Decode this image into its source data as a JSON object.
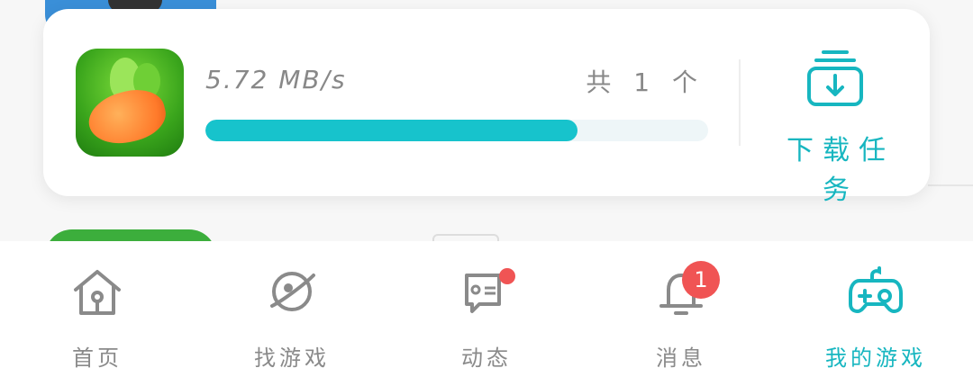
{
  "download_card": {
    "speed": "5.72 MB/s",
    "count": "共 1 个",
    "progress_percent": 74,
    "task_label": "下载任务"
  },
  "tabs": [
    {
      "label": "首页",
      "icon": "home-icon",
      "active": false
    },
    {
      "label": "找游戏",
      "icon": "planet-icon",
      "active": false
    },
    {
      "label": "动态",
      "icon": "message-icon",
      "active": false
    },
    {
      "label": "消息",
      "icon": "bell-icon",
      "active": false
    },
    {
      "label": "我的游戏",
      "icon": "gamepad-icon",
      "active": true
    }
  ],
  "badges": {
    "messages_count": "1"
  },
  "colors": {
    "accent": "#17b6c0",
    "progress": "#17c3cc",
    "badge": "#f05454"
  }
}
